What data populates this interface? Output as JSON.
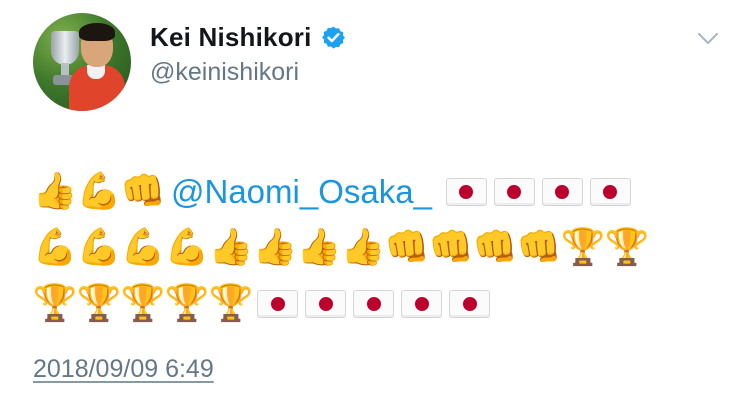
{
  "user": {
    "display_name": "Kei Nishikori",
    "handle": "@keinishikori",
    "verified": true,
    "avatar_icon": "profile-photo-with-trophy"
  },
  "menu": {
    "icon": "chevron-down-icon"
  },
  "tweet": {
    "mention": "@Naomi_Osaka_",
    "lines": [
      [
        "thumbs-up",
        "flexed-biceps",
        "oncoming-fist",
        "@mention",
        "japan-flag",
        "japan-flag",
        "japan-flag",
        "japan-flag"
      ],
      [
        "flexed-biceps",
        "flexed-biceps",
        "flexed-biceps",
        "flexed-biceps",
        "thumbs-up",
        "thumbs-up",
        "thumbs-up",
        "thumbs-up",
        "oncoming-fist",
        "oncoming-fist",
        "oncoming-fist",
        "oncoming-fist",
        "trophy",
        "trophy"
      ],
      [
        "trophy",
        "trophy",
        "trophy",
        "trophy",
        "trophy",
        "japan-flag",
        "japan-flag",
        "japan-flag",
        "japan-flag",
        "japan-flag"
      ]
    ]
  },
  "timestamp": "2018/09/09 6:49",
  "colors": {
    "link": "#1b95e0",
    "secondary_text": "#657786",
    "verified_badge": "#1da1f2",
    "flag_red": "#bc002d"
  }
}
